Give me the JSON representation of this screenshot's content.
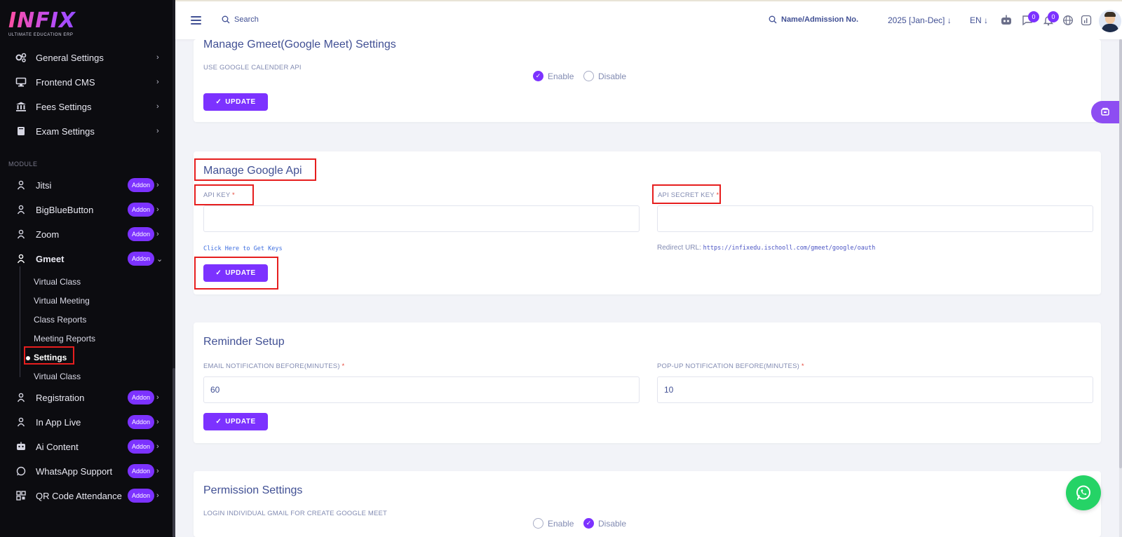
{
  "brand": {
    "logo_text": "INFIX",
    "logo_sub": "ULTIMATE EDUCATION ERP"
  },
  "sidebar": {
    "settings_items": [
      {
        "label": "General Settings",
        "icon": "gears-icon"
      },
      {
        "label": "Frontend CMS",
        "icon": "monitor-icon"
      },
      {
        "label": "Fees Settings",
        "icon": "bank-icon"
      },
      {
        "label": "Exam Settings",
        "icon": "book-icon"
      }
    ],
    "module_title": "MODULE",
    "addon_label": "Addon",
    "modules": [
      {
        "label": "Jitsi"
      },
      {
        "label": "BigBlueButton"
      },
      {
        "label": "Zoom"
      },
      {
        "label": "Gmeet"
      },
      {
        "label": "Registration"
      },
      {
        "label": "In App Live"
      },
      {
        "label": "Ai Content"
      },
      {
        "label": "WhatsApp Support"
      },
      {
        "label": "QR Code Attendance"
      }
    ],
    "gmeet_sub": [
      "Virtual Class",
      "Virtual Meeting",
      "Class Reports",
      "Meeting Reports",
      "Settings",
      "Virtual Class"
    ]
  },
  "header": {
    "search": "Search",
    "student_search": "Name/Admission No.",
    "year": "2025 [Jan-Dec]",
    "lang": "EN",
    "messages_count": "0",
    "notifications_count": "0"
  },
  "gmeet_settings": {
    "title": "Manage Gmeet(Google Meet) Settings",
    "label": "USE GOOGLE CALENDER API",
    "enable": "Enable",
    "disable": "Disable",
    "update": "UPDATE"
  },
  "google_api": {
    "title": "Manage Google Api",
    "api_key_label": "API KEY",
    "api_secret_label": "API SECRET KEY",
    "required": "*",
    "api_key_value": "",
    "api_secret_value": "",
    "get_keys": "Click Here to Get Keys",
    "redirect_label": "Redirect URL:",
    "redirect_url": "https://infixedu.ischooll.com/gmeet/google/oauth",
    "update": "UPDATE"
  },
  "reminder": {
    "title": "Reminder Setup",
    "email_label": "EMAIL NOTIFICATION BEFORE(MINUTES)",
    "popup_label": "POP-UP NOTIFICATION BEFORE(MINUTES)",
    "required": "*",
    "email_value": "60",
    "popup_value": "10",
    "update": "UPDATE"
  },
  "permission": {
    "title": "Permission Settings",
    "label": "LOGIN INDIVIDUAL GMAIL FOR CREATE GOOGLE MEET",
    "enable": "Enable",
    "disable": "Disable"
  }
}
